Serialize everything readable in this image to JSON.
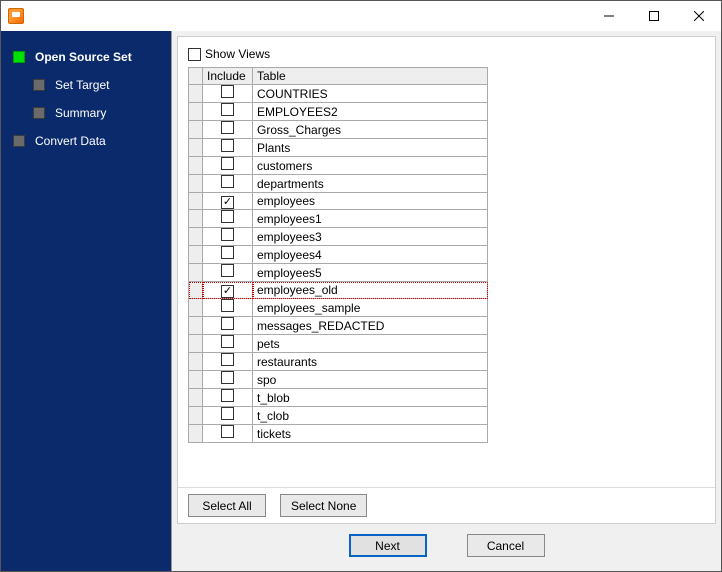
{
  "titlebar": {
    "title": ""
  },
  "sidebar": {
    "steps": [
      {
        "label": "Open Source Set",
        "active": true,
        "indent": 0
      },
      {
        "label": "Set Target",
        "active": false,
        "indent": 1
      },
      {
        "label": "Summary",
        "active": false,
        "indent": 1
      },
      {
        "label": "Convert Data",
        "active": false,
        "indent": 0
      }
    ]
  },
  "showViews": {
    "label": "Show Views",
    "checked": false
  },
  "table": {
    "headers": {
      "include": "Include",
      "table": "Table"
    },
    "rows": [
      {
        "include": false,
        "name": "COUNTRIES",
        "hl": false
      },
      {
        "include": false,
        "name": "EMPLOYEES2",
        "hl": false
      },
      {
        "include": false,
        "name": "Gross_Charges",
        "hl": false
      },
      {
        "include": false,
        "name": "Plants",
        "hl": false
      },
      {
        "include": false,
        "name": "customers",
        "hl": false
      },
      {
        "include": false,
        "name": "departments",
        "hl": false
      },
      {
        "include": true,
        "name": "employees",
        "hl": false
      },
      {
        "include": false,
        "name": "employees1",
        "hl": false
      },
      {
        "include": false,
        "name": "employees3",
        "hl": false
      },
      {
        "include": false,
        "name": "employees4",
        "hl": false
      },
      {
        "include": false,
        "name": "employees5",
        "hl": false
      },
      {
        "include": true,
        "name": "employees_old",
        "hl": true
      },
      {
        "include": false,
        "name": "employees_sample",
        "hl": false
      },
      {
        "include": false,
        "name": "messages_REDACTED",
        "hl": false
      },
      {
        "include": false,
        "name": "pets",
        "hl": false
      },
      {
        "include": false,
        "name": "restaurants",
        "hl": false
      },
      {
        "include": false,
        "name": "spo",
        "hl": false
      },
      {
        "include": false,
        "name": "t_blob",
        "hl": false
      },
      {
        "include": false,
        "name": "t_clob",
        "hl": false
      },
      {
        "include": false,
        "name": "tickets",
        "hl": false
      }
    ]
  },
  "buttons": {
    "selectAll": "Select All",
    "selectNone": "Select None",
    "next": "Next",
    "cancel": "Cancel"
  }
}
